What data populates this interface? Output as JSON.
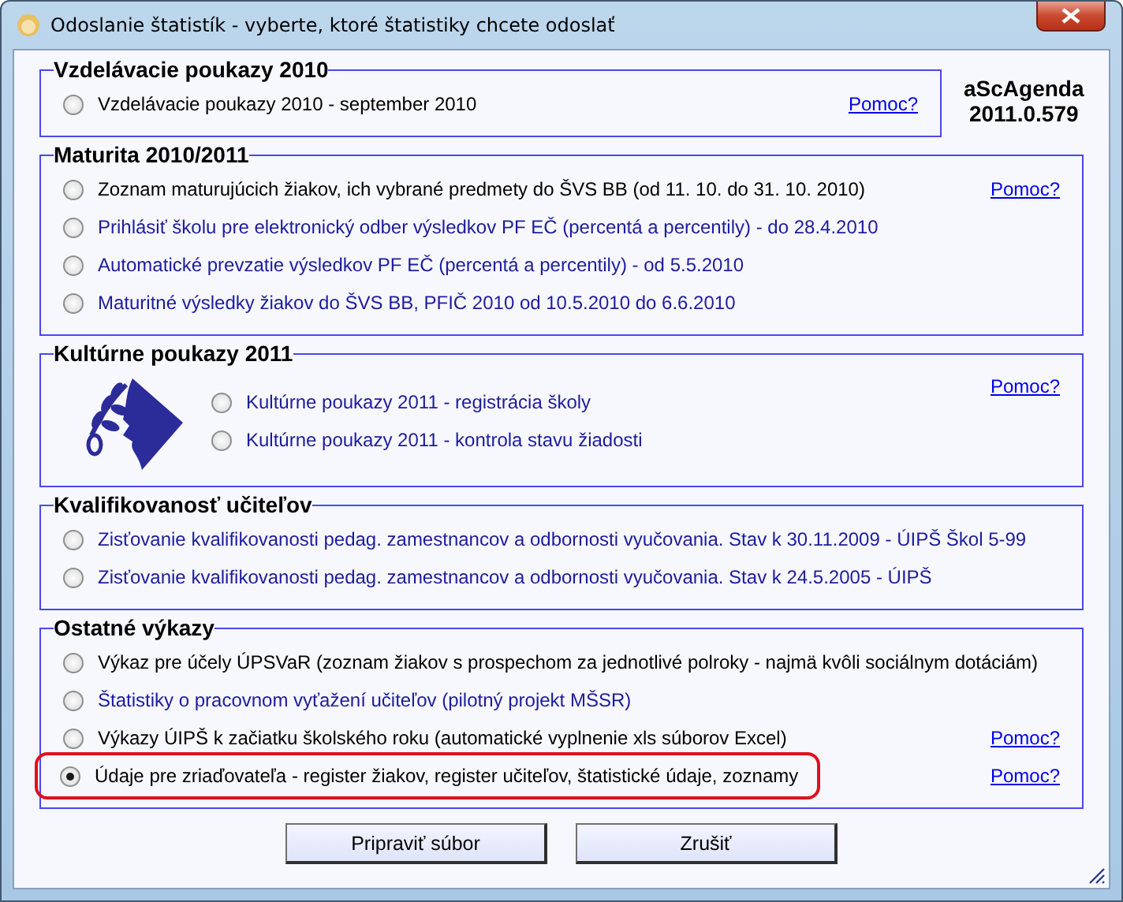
{
  "window": {
    "title": "Odoslanie štatistík - vyberte, ktoré štatistiky chcete odoslať"
  },
  "version": {
    "product": "aScAgenda",
    "number": "2011.0.579"
  },
  "groups": [
    {
      "title": "Vzdelávacie poukazy 2010",
      "options": [
        {
          "label": "Vzdelávacie poukazy 2010 - september 2010",
          "selected": false,
          "color": "#000000",
          "help": "Pomoc?"
        }
      ]
    },
    {
      "title": "Maturita 2010/2011",
      "options": [
        {
          "label": "Zoznam maturujúcich žiakov, ich vybrané predmety do ŠVS BB (od 11. 10. do 31. 10. 2010)",
          "selected": false,
          "color": "#000000",
          "help": "Pomoc?"
        },
        {
          "label": "Prihlásiť školu pre elektronický odber výsledkov PF EČ (percentá a percentily) - do 28.4.2010",
          "selected": false,
          "color": "#1c1c9c"
        },
        {
          "label": "Automatické prevzatie výsledkov PF EČ (percentá a percentily) - od 5.5.2010",
          "selected": false,
          "color": "#1c1c9c"
        },
        {
          "label": "Maturitné výsledky žiakov do ŠVS BB, PFIČ 2010 od 10.5.2010 do 6.6.2010",
          "selected": false,
          "color": "#1c1c9c"
        }
      ]
    },
    {
      "title": "Kultúrne poukazy 2011",
      "logo": true,
      "help": "Pomoc?",
      "options": [
        {
          "label": "Kultúrne poukazy 2011 - registrácia školy",
          "selected": false,
          "color": "#1c1c9c"
        },
        {
          "label": "Kultúrne poukazy 2011 - kontrola stavu žiadosti",
          "selected": false,
          "color": "#1c1c9c"
        }
      ]
    },
    {
      "title": "Kvalifikovanosť učiteľov",
      "options": [
        {
          "label": "Zisťovanie kvalifikovanosti pedag. zamestnancov a odbornosti vyučovania. Stav k 30.11.2009 - ÚIPŠ Škol 5-99",
          "selected": false,
          "color": "#1c1c9c"
        },
        {
          "label": "Zisťovanie kvalifikovanosti pedag. zamestnancov a odbornosti vyučovania. Stav k 24.5.2005 - ÚIPŠ",
          "selected": false,
          "color": "#1c1c9c"
        }
      ]
    },
    {
      "title": "Ostatné výkazy",
      "options": [
        {
          "label": "Výkaz pre účely ÚPSVaR (zoznam žiakov s prospechom za jednotlivé polroky - najmä kvôli sociálnym dotáciám)",
          "selected": false,
          "color": "#000000"
        },
        {
          "label": "Štatistiky o pracovnom vyťažení učiteľov (pilotný projekt MŠSR)",
          "selected": false,
          "color": "#1c1c9c"
        },
        {
          "label": "Výkazy ÚIPŠ k začiatku školského roku (automatické vyplnenie xls súborov Excel)",
          "selected": false,
          "color": "#000000",
          "help": "Pomoc?"
        },
        {
          "label": "Údaje pre zriaďovateľa - register žiakov, register učiteľov, štatistické údaje, zoznamy",
          "selected": true,
          "color": "#000000",
          "circled": true,
          "help": "Pomoc?"
        }
      ]
    }
  ],
  "buttons": [
    "Pripraviť súbor",
    "Zrušiť"
  ]
}
